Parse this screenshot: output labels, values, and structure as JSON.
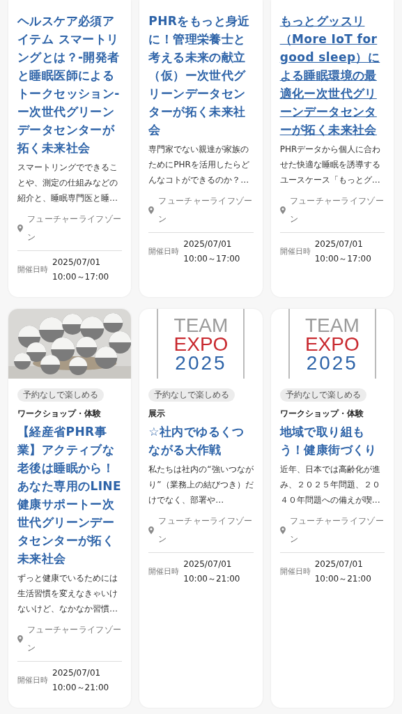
{
  "cards": [
    {
      "title": "ヘルスケア必須アイテム スマートリングとは？-開発者と睡眠医師によるトークセッション-ー次世代グリーンデータセンターが拓く未来社会",
      "hovered": false,
      "description": "スマートリングでできることや、測定の仕組みなどの紹介と、睡眠専門医と睡…",
      "location": "フューチャーライフゾーン",
      "date_label": "開催日時",
      "date": "2025/07/01",
      "time": "10:00～17:00"
    },
    {
      "title": "PHRをもっと身近に！管理栄養士と考える未来の献立（仮）ー次世代グリーンデータセンターが拓く未来社会",
      "hovered": false,
      "description": "専門家でない親達が家族のためにPHRを活用したらどんなコトができるのか？…",
      "location": "フューチャーライフゾーン",
      "date_label": "開催日時",
      "date": "2025/07/01",
      "time": "10:00～17:00"
    },
    {
      "title": "もっとグッスリ（More IoT for good sleep）による睡眠環境の最適化ー次世代グリーンデータセンターが拓く未来社会",
      "hovered": true,
      "description": "PHRデータから個人に合わせた快適な睡眠を誘導するユースケース「もっとグ…",
      "location": "フューチャーライフゾーン",
      "date_label": "開催日時",
      "date": "2025/07/01",
      "time": "10:00～17:00"
    },
    {
      "tag": "予約なしで楽しめる",
      "category": "ワークショップ・体験",
      "title": "【経産省PHR事業】アクティブな老後は睡眠から！あなた専用のLINE健康サポートー次世代グリーンデータセンターが拓く未来社会",
      "hovered": false,
      "description": "ずっと健康でいるためには生活習慣を変えなきゃいけないけど、なかなか習慣…",
      "location": "フューチャーライフゾーン",
      "date_label": "開催日時",
      "date": "2025/07/01",
      "time": "10:00～21:00"
    },
    {
      "media": {
        "kind": "logo",
        "lines": [
          {
            "text": "TEAM",
            "color": "#9a9a9a"
          },
          {
            "text": "EXPO",
            "color": "#c8282e"
          },
          {
            "text": "2025",
            "color": "#2d63a8"
          }
        ]
      },
      "tag": "予約なしで楽しめる",
      "category": "展示",
      "title": "☆社内でゆるくつながる大作戦",
      "hovered": false,
      "description": "私たちは社内の“強いつながり”（業務上の結びつき）だけでなく、部署や…",
      "location": "フューチャーライフゾーン",
      "date_label": "開催日時",
      "date": "2025/07/01",
      "time": "10:00～21:00"
    },
    {
      "media": {
        "kind": "logo",
        "lines": [
          {
            "text": "TEAM",
            "color": "#9a9a9a"
          },
          {
            "text": "EXPO",
            "color": "#c8282e"
          },
          {
            "text": "2025",
            "color": "#2d63a8"
          }
        ]
      },
      "tag": "予約なしで楽しめる",
      "category": "ワークショップ・体験",
      "title": "地域で取り組もう！健康街づくり",
      "hovered": false,
      "description": "近年、日本では高齢化が進み、２０２５年問題、２０４０年問題への備えが喫…",
      "location": "フューチャーライフゾーン",
      "date_label": "開催日時",
      "date": "2025/07/01",
      "time": "10:00～21:00"
    }
  ]
}
